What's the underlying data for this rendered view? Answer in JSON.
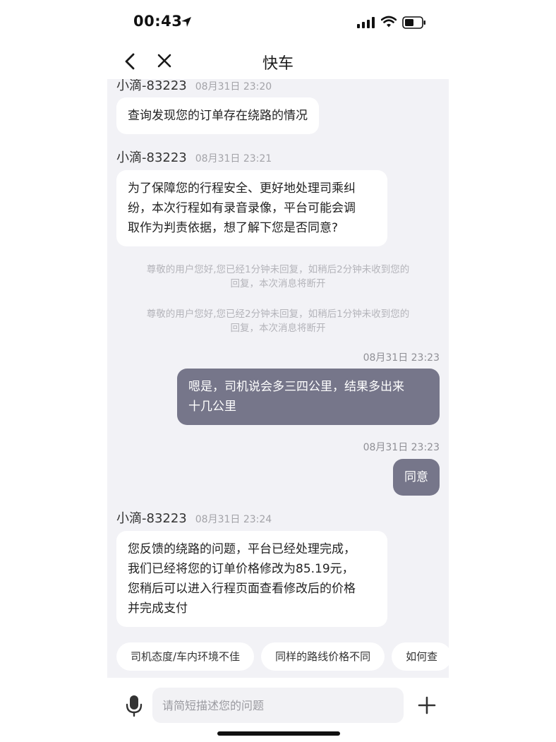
{
  "status_bar": {
    "time": "00:43",
    "icons": [
      "location-arrow-icon",
      "signal-icon",
      "wifi-icon",
      "battery-icon"
    ]
  },
  "nav": {
    "title": "快车",
    "back_icon": "chevron-left-icon",
    "close_icon": "close-icon"
  },
  "messages": [
    {
      "sender": "小滴-83223",
      "time": "08月31日 23:20",
      "text": "查询发现您的订单存在绕路的情况"
    },
    {
      "sender": "小滴-83223",
      "time": "08月31日 23:21",
      "lines": [
        "为了保障您的行程安全、更好地处理司乘纠",
        "纷，本次行程如有录音录像，平台可能会调",
        "取作为判责依据，想了解下您是否同意?"
      ]
    },
    {
      "system": [
        "尊敬的用户您好,您已经1分钟未回复，如稍后2分钟未收到您的",
        "回复，本次消息将断开"
      ]
    },
    {
      "system": [
        "尊敬的用户您好,您已经2分钟未回复，如稍后1分钟未收到您的",
        "回复，本次消息将断开"
      ]
    },
    {
      "time": "08月31日 23:23",
      "lines": [
        "嗯是，司机说会多三四公里，结果多出来",
        "十几公里"
      ]
    },
    {
      "time": "08月31日 23:23",
      "text": "同意"
    },
    {
      "sender": "小滴-83223",
      "time": "08月31日 23:24",
      "lines": [
        "您反馈的绕路的问题，平台已经处理完成，",
        "我们已经将您的订单价格修改为85.19元，",
        "您稍后可以进入行程页面查看修改后的价格",
        "并完成支付"
      ]
    }
  ],
  "quick_replies": [
    "司机态度/车内环境不佳",
    "同样的路线价格不同",
    "如何查"
  ],
  "input": {
    "placeholder": "请简短描述您的问题",
    "value": "",
    "mic_icon": "microphone-icon",
    "plus_icon": "plus-icon"
  },
  "colors": {
    "chat_background": "#f2f2f6",
    "outgoing_bubble": "#76768a",
    "incoming_bubble": "#ffffff"
  }
}
